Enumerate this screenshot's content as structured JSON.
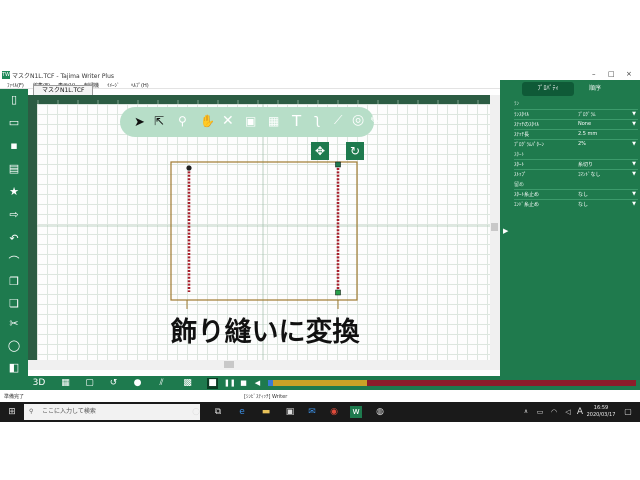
{
  "window": {
    "title": "マスクN1L.TCF - Tajima Writer Plus",
    "min": "–",
    "max": "□",
    "close": "×"
  },
  "menu": [
    {
      "label": "ﾌｧｲﾙ(F)"
    },
    {
      "label": "編集(E)"
    },
    {
      "label": "表示(V)"
    },
    {
      "label": "刺繍機"
    },
    {
      "label": "ｲﾒｰｼﾞ"
    },
    {
      "label": "ﾍﾙﾌﾟ(H)"
    }
  ],
  "document_tab": "マスクN1L.TCF",
  "panel": {
    "tabs": [
      "ﾌﾟﾛﾊﾟﾃｨ",
      "順序"
    ],
    "sections": {
      "stitch": "ﾗﾝ",
      "start_end": "ｽﾀｰﾄ",
      "tie": "留め"
    },
    "rows": {
      "stitch_style": {
        "label": "ﾗﾝｽﾀｲﾙ",
        "value": "ﾌﾟﾛｸﾞﾗﾑ"
      },
      "stitch_style_2": {
        "label": "ｽﾃｯﾁのｽﾀｲﾙ",
        "value": "None"
      },
      "stitch_length": {
        "label": "ｽﾃｯﾁ長",
        "value": "2.5 mm"
      },
      "program_pattern": {
        "label": "ﾌﾟﾛｸﾞﾗﾑﾊﾟﾀｰﾝ",
        "value": "2%"
      },
      "start": {
        "label": "ｽﾀｰﾄ",
        "value": "糸切り"
      },
      "stop": {
        "label": "ｽﾄｯﾌﾟ",
        "value": "ｺﾏﾝﾄﾞなし"
      },
      "start_tie": {
        "label": "ｽﾀｰﾄ糸止め",
        "value": "なし"
      },
      "end_tie": {
        "label": "ｴﾝﾄﾞ糸止め",
        "value": "なし"
      }
    }
  },
  "caption": "飾り縫いに変換",
  "status": {
    "left": "準備完了",
    "center": "[ｼﾝﾋﾞｽﾃｨｯﾁ] Writer"
  },
  "progress": {
    "fraction": 0.27
  },
  "taskbar": {
    "search_placeholder": "ここに入力して検索",
    "time": "16:59",
    "date": "2020/03/17",
    "ime": "A"
  },
  "colors": {
    "app_green": "#1e7a4e",
    "accent_dark": "#0f5a37",
    "stitch": "#a81e2c",
    "frame": "#a07a30"
  }
}
